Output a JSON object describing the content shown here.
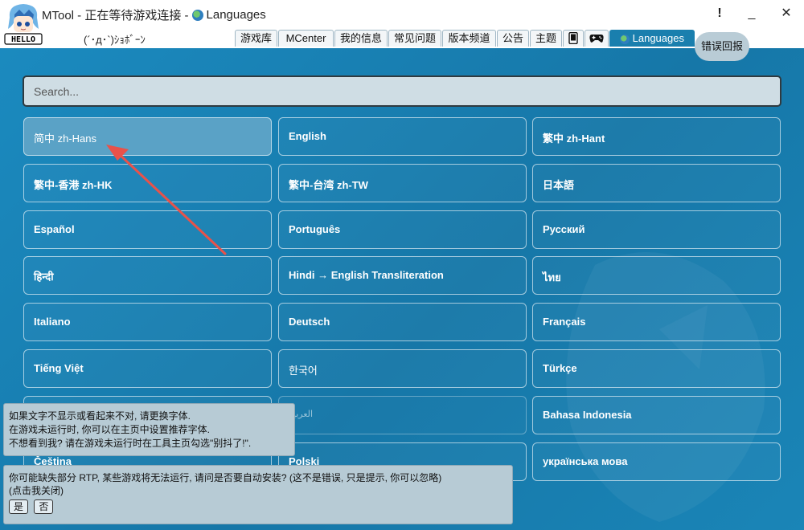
{
  "window": {
    "title": "MTool - 正在等待游戏连接 -",
    "title_suffix": "Languages",
    "minimize_label": "_",
    "close_label": "✕",
    "alert_label": "!"
  },
  "logo": {
    "text": "HELLO"
  },
  "kaomoji": "(´･д･`)ｼｮﾎﾞｰﾝ",
  "tabs": [
    {
      "label": "游戏库"
    },
    {
      "label": "MCenter"
    },
    {
      "label": "我的信息"
    },
    {
      "label": "常见问题"
    },
    {
      "label": "版本频道"
    },
    {
      "label": "公告"
    },
    {
      "label": "主题"
    },
    {
      "label": "Languages"
    }
  ],
  "tab_icons": [
    "phone-icon",
    "gamepad-icon"
  ],
  "tooltip": "错误回报",
  "search": {
    "placeholder": "Search..."
  },
  "languages": [
    {
      "label": "简中 zh-Hans",
      "selected": true
    },
    {
      "label": "English"
    },
    {
      "label": "繁中 zh-Hant"
    },
    {
      "label": "繁中-香港 zh-HK"
    },
    {
      "label": "繁中-台湾 zh-TW"
    },
    {
      "label": "日本語"
    },
    {
      "label": "Español"
    },
    {
      "label": "Português"
    },
    {
      "label": "Русский"
    },
    {
      "label": "हिन्दी"
    },
    {
      "label": "Hindi → English Transliteration"
    },
    {
      "label": "ไทย"
    },
    {
      "label": "Italiano"
    },
    {
      "label": "Deutsch"
    },
    {
      "label": "Français"
    },
    {
      "label": "Tiếng Việt"
    },
    {
      "label": "한국어"
    },
    {
      "label": "Türkçe"
    },
    {
      "label": ""
    },
    {
      "label": "العربية"
    },
    {
      "label": "Bahasa Indonesia"
    },
    {
      "label": "Čeština"
    },
    {
      "label": "Polski"
    },
    {
      "label": "українська мова"
    }
  ],
  "font_notice": {
    "line1": "如果文字不显示或看起来不对, 请更换字体.",
    "line2": "在游戏未运行时, 你可以在主页中设置推荐字体.",
    "line3": "不想看到我? 请在游戏未运行时在工具主页勾选\"别抖了!\"."
  },
  "rtp_notice": {
    "line1": "你可能缺失部分 RTP, 某些游戏将无法运行, 请问是否要自动安装? (这不是错误, 只是提示, 你可以忽略)",
    "line2": "(点击我关闭)",
    "yes_label": "是",
    "no_label": "否"
  },
  "colors": {
    "background": "#1a7fae",
    "selected_button": "#5aa2c6",
    "arrow": "#e8524a",
    "notice_bg": "#b7cbd5"
  }
}
